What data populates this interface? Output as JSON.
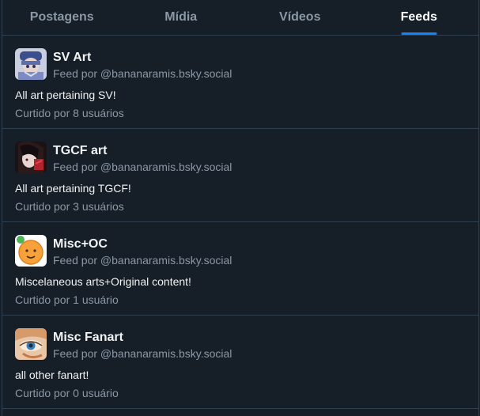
{
  "tabs": [
    {
      "label": "Postagens",
      "active": false
    },
    {
      "label": "Mídia",
      "active": false
    },
    {
      "label": "Vídeos",
      "active": false
    },
    {
      "label": "Feeds",
      "active": true
    }
  ],
  "feeds": [
    {
      "title": "SV Art",
      "by": "Feed por @bananaramis.bsky.social",
      "description": "All art pertaining SV!",
      "likes": "Curtido por 8 usuários",
      "avatar": "sv-art-avatar"
    },
    {
      "title": "TGCF art",
      "by": "Feed por @bananaramis.bsky.social",
      "description": "All art pertaining TGCF!",
      "likes": "Curtido por 3 usuários",
      "avatar": "tgcf-art-avatar"
    },
    {
      "title": "Misc+OC",
      "by": "Feed por @bananaramis.bsky.social",
      "description": "Miscelaneous arts+Original content!",
      "likes": "Curtido por 1 usuário",
      "avatar": "misc-oc-avatar"
    },
    {
      "title": "Misc Fanart",
      "by": "Feed por @bananaramis.bsky.social",
      "description": "all other fanart!",
      "likes": "Curtido por 0 usuário",
      "avatar": "misc-fanart-avatar"
    }
  ],
  "colors": {
    "background": "#161e27",
    "border": "#2e4052",
    "accent": "#1083fe",
    "muted_text": "#8b98a5"
  }
}
